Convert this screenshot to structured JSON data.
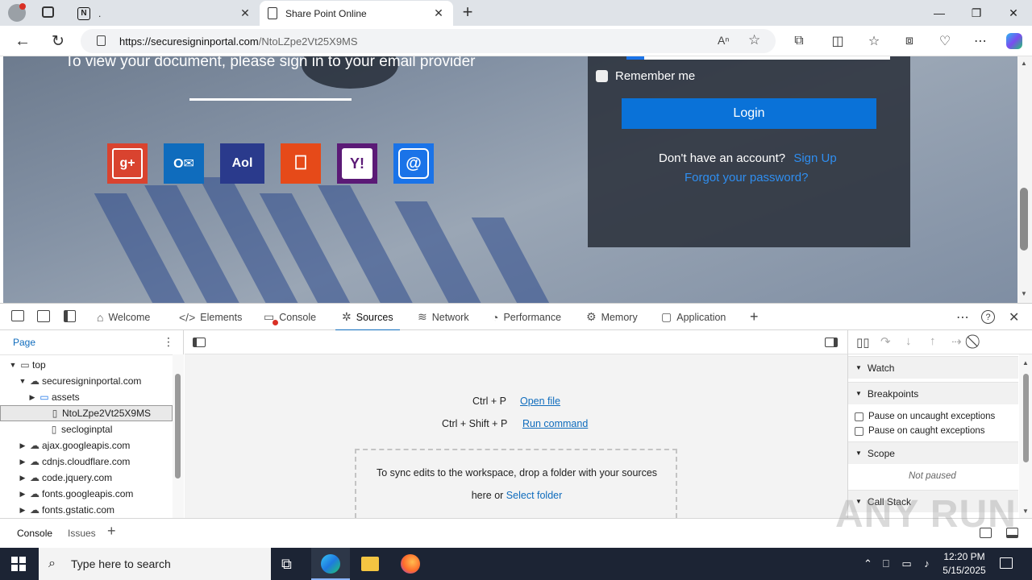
{
  "browser": {
    "tabs": [
      {
        "title": "."
      },
      {
        "title": "Share Point Online"
      }
    ],
    "new_tab": "+",
    "window_controls": {
      "minimize": "—",
      "restore": "❐",
      "close": "✕"
    },
    "url_host": "https://securesigninportal.com",
    "url_path": "/NtoLZpe2Vt25X9MS"
  },
  "page": {
    "heading": "To view your document, please sign in to your email provider",
    "providers": [
      {
        "name": "google-plus",
        "glyph": "g+",
        "color": "#d9432f"
      },
      {
        "name": "outlook",
        "glyph": "O✉",
        "color": "#0f6cbd"
      },
      {
        "name": "aol",
        "glyph": "Aol",
        "color": "#2a3a8c"
      },
      {
        "name": "office",
        "glyph": "⎕",
        "color": "#e64a19"
      },
      {
        "name": "yahoo",
        "glyph": "Y!",
        "color": "#5b1a76"
      },
      {
        "name": "other-email",
        "glyph": "@",
        "color": "#1a73e8"
      }
    ],
    "login": {
      "remember_label": "Remember me",
      "login_button": "Login",
      "no_account": "Don't have an account?",
      "sign_up": "Sign Up",
      "forgot": "Forgot your password?"
    }
  },
  "devtools": {
    "tabs": [
      "Welcome",
      "Elements",
      "Console",
      "Sources",
      "Network",
      "Performance",
      "Memory",
      "Application"
    ],
    "active_tab": "Sources",
    "navigator_tab": "Page",
    "tree": [
      {
        "label": "top",
        "icon": "window",
        "level": 0,
        "toggle": "▼"
      },
      {
        "label": "securesigninportal.com",
        "icon": "cloud",
        "level": 1,
        "toggle": "▼"
      },
      {
        "label": "assets",
        "icon": "folder",
        "level": 2,
        "toggle": "▶"
      },
      {
        "label": "NtoLZpe2Vt25X9MS",
        "icon": "file",
        "level": 3,
        "toggle": ""
      },
      {
        "label": "secloginptal",
        "icon": "file",
        "level": 3,
        "toggle": ""
      },
      {
        "label": "ajax.googleapis.com",
        "icon": "cloud",
        "level": 1,
        "toggle": "▶"
      },
      {
        "label": "cdnjs.cloudflare.com",
        "icon": "cloud",
        "level": 1,
        "toggle": "▶"
      },
      {
        "label": "code.jquery.com",
        "icon": "cloud",
        "level": 1,
        "toggle": "▶"
      },
      {
        "label": "fonts.googleapis.com",
        "icon": "cloud",
        "level": 1,
        "toggle": "▶"
      },
      {
        "label": "fonts.gstatic.com",
        "icon": "cloud",
        "level": 1,
        "toggle": "▶"
      }
    ],
    "selected_file": "NtoLZpe2Vt25X9MS",
    "shortcuts": [
      {
        "keys": "Ctrl + P",
        "action": "Open file"
      },
      {
        "keys": "Ctrl + Shift + P",
        "action": "Run command"
      }
    ],
    "workspace_text": "To sync edits to the workspace, drop a folder with your sources here or",
    "workspace_link": "Select folder",
    "debugger": {
      "watch": "Watch",
      "breakpoints": "Breakpoints",
      "pause_uncaught": "Pause on uncaught exceptions",
      "pause_caught": "Pause on caught exceptions",
      "scope": "Scope",
      "not_paused": "Not paused",
      "call_stack": "Call Stack"
    },
    "drawer_tabs": [
      "Console",
      "Issues"
    ]
  },
  "taskbar": {
    "search_placeholder": "Type here to search",
    "time": "12:20 PM",
    "date": "5/15/2025"
  },
  "watermark": "ANY RUN"
}
